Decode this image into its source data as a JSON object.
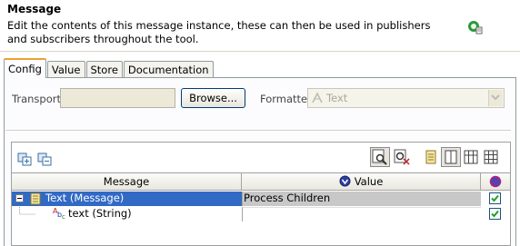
{
  "header": {
    "title": "Message",
    "description": "Edit the contents of this message instance, these can then be used in publishers and subscribers throughout the tool."
  },
  "tabs": [
    {
      "label": "Config",
      "active": true
    },
    {
      "label": "Value",
      "active": false
    },
    {
      "label": "Store",
      "active": false
    },
    {
      "label": "Documentation",
      "active": false
    }
  ],
  "config": {
    "transport_label": "Transport",
    "transport_value": "",
    "browse_label": "Browse...",
    "formatter_label": "Formatter",
    "formatter_value": "Text"
  },
  "table": {
    "columns": [
      "Message",
      "Value",
      ""
    ],
    "rows": [
      {
        "name": "Text (Message)",
        "value": "Process Children",
        "checked": true,
        "selected": true
      },
      {
        "name": "text (String)",
        "value": "",
        "checked": true,
        "selected": false
      }
    ]
  },
  "colors": {
    "selection": "#316ac5",
    "tab_accent": "#f0a030",
    "checkbox_check": "#21a121"
  }
}
